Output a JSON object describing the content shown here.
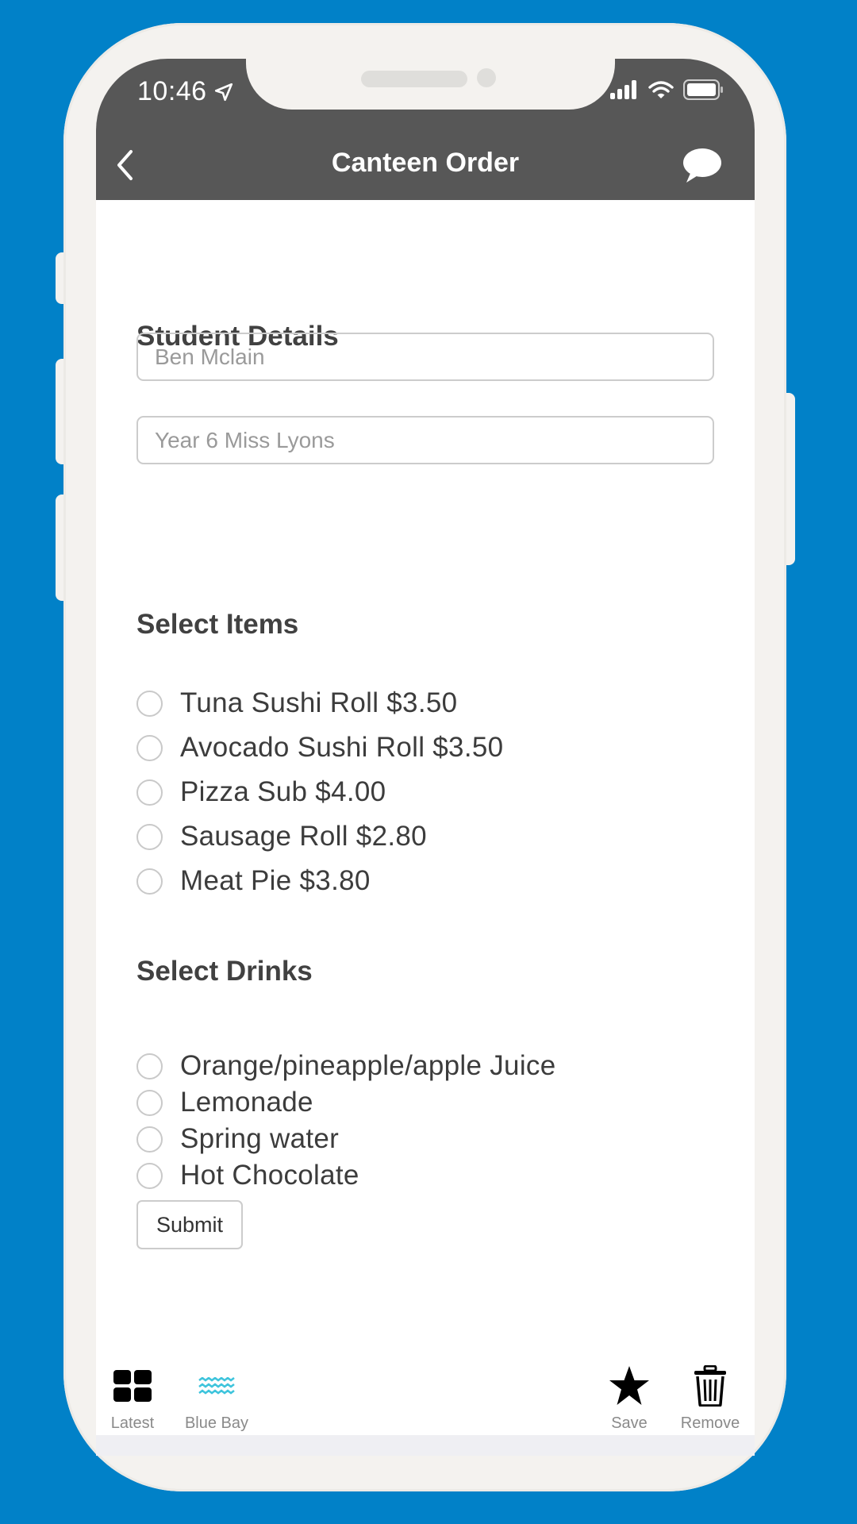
{
  "status_bar": {
    "time": "10:46",
    "icons": [
      "location-arrow-icon",
      "signal-icon",
      "wifi-icon",
      "battery-icon"
    ]
  },
  "header": {
    "title": "Canteen Order",
    "back_icon": "chevron-left-icon",
    "action_icon": "chat-bubble-icon",
    "background": "#575757"
  },
  "student_details": {
    "heading": "Student Details",
    "name_placeholder": "Ben Mclain",
    "class_placeholder": "Year 6 Miss Lyons"
  },
  "items": {
    "heading": "Select Items",
    "options": [
      {
        "label": "Tuna Sushi Roll $3.50",
        "selected": false
      },
      {
        "label": "Avocado Sushi Roll $3.50",
        "selected": false
      },
      {
        "label": "Pizza Sub $4.00",
        "selected": false
      },
      {
        "label": "Sausage Roll $2.80",
        "selected": false
      },
      {
        "label": "Meat Pie $3.80",
        "selected": false
      }
    ]
  },
  "drinks": {
    "heading": "Select Drinks",
    "options": [
      {
        "label": "Orange/pineapple/apple Juice",
        "selected": false
      },
      {
        "label": "Lemonade",
        "selected": false
      },
      {
        "label": "Spring water",
        "selected": false
      },
      {
        "label": "Hot Chocolate",
        "selected": false
      }
    ]
  },
  "submit_label": "Submit",
  "tab_bar": {
    "tabs": [
      {
        "label": "Latest",
        "icon": "grid-icon"
      },
      {
        "label": "Blue Bay",
        "icon": "waves-icon",
        "color": "#3ec4dc"
      },
      {
        "label": "Save",
        "icon": "star-icon"
      },
      {
        "label": "Remove",
        "icon": "trash-icon"
      }
    ]
  },
  "colors": {
    "background": "#0181c8",
    "phone_frame": "#f4f2ef"
  }
}
